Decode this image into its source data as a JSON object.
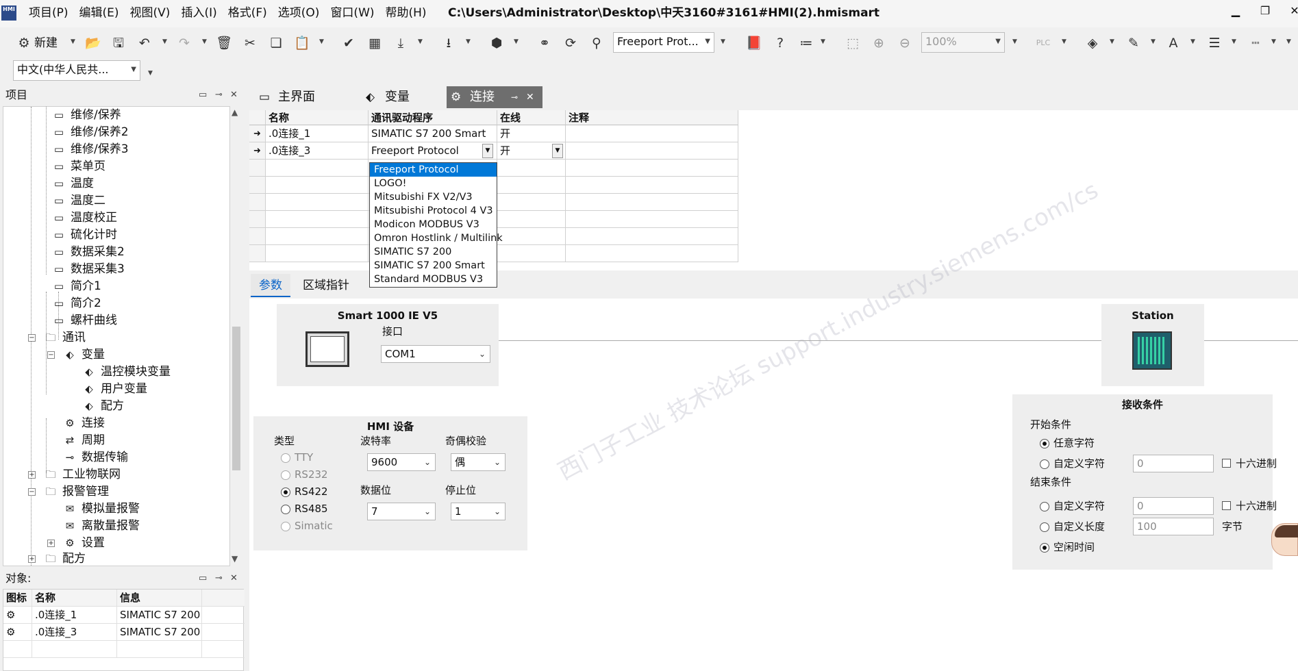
{
  "window": {
    "path": "C:\\Users\\Administrator\\Desktop\\中天3160#3161#HMI(2).hmismart",
    "logo_text": "HMI"
  },
  "menu": [
    "项目(P)",
    "编辑(E)",
    "视图(V)",
    "插入(I)",
    "格式(F)",
    "选项(O)",
    "窗口(W)",
    "帮助(H)"
  ],
  "toolbar": {
    "new_label": "新建",
    "protocol_combo": "Freeport Prot...",
    "zoom_combo": "100%",
    "language_combo": "中文(中华人民共..."
  },
  "project_panel": {
    "title": "项目",
    "tree": [
      {
        "label": "维修/保养",
        "icon": "screen-icon"
      },
      {
        "label": "维修/保养2",
        "icon": "screen-icon"
      },
      {
        "label": "维修/保养3",
        "icon": "screen-icon"
      },
      {
        "label": "菜单页",
        "icon": "screen-icon"
      },
      {
        "label": "温度",
        "icon": "screen-icon"
      },
      {
        "label": "温度二",
        "icon": "screen-icon"
      },
      {
        "label": "温度校正",
        "icon": "screen-icon"
      },
      {
        "label": "硫化计时",
        "icon": "screen-icon"
      },
      {
        "label": "数据采集2",
        "icon": "screen-icon"
      },
      {
        "label": "数据采集3",
        "icon": "screen-icon"
      },
      {
        "label": "简介1",
        "icon": "screen-icon"
      },
      {
        "label": "简介2",
        "icon": "screen-icon"
      },
      {
        "label": "螺杆曲线",
        "icon": "screen-icon"
      },
      {
        "label": "通讯",
        "icon": "folder-icon"
      },
      {
        "label": "变量",
        "icon": "tag-icon"
      },
      {
        "label": "温控模块变量",
        "icon": "tag-icon"
      },
      {
        "label": "用户变量",
        "icon": "tag-icon"
      },
      {
        "label": "配方",
        "icon": "tag-icon"
      },
      {
        "label": "连接",
        "icon": "connection-icon"
      },
      {
        "label": "周期",
        "icon": "cycle-icon"
      },
      {
        "label": "数据传输",
        "icon": "transfer-icon"
      },
      {
        "label": "工业物联网",
        "icon": "folder-icon"
      },
      {
        "label": "报警管理",
        "icon": "folder-icon"
      },
      {
        "label": "模拟量报警",
        "icon": "alarm-icon"
      },
      {
        "label": "离散量报警",
        "icon": "alarm-icon"
      },
      {
        "label": "设置",
        "icon": "settings-icon"
      },
      {
        "label": "配方",
        "icon": "folder-icon"
      }
    ]
  },
  "object_panel": {
    "title": "对象:",
    "headers": [
      "图标",
      "名称",
      "信息"
    ],
    "rows": [
      {
        "name": ".0连接_1",
        "info": "SIMATIC S7 200 ..."
      },
      {
        "name": ".0连接_3",
        "info": "SIMATIC S7 200 ..."
      }
    ]
  },
  "tabs": [
    {
      "label": "主界面",
      "icon": "screen-icon"
    },
    {
      "label": "变量",
      "icon": "tag-icon"
    },
    {
      "label": "连接",
      "icon": "connection-icon"
    }
  ],
  "grid": {
    "headers": [
      "名称",
      "通讯驱动程序",
      "在线",
      "注释"
    ],
    "rows": [
      {
        "name": ".0连接_1",
        "driver": "SIMATIC S7 200 Smart",
        "online": "开",
        "comment": ""
      },
      {
        "name": ".0连接_3",
        "driver": "Freeport Protocol",
        "online": "开",
        "comment": ""
      }
    ]
  },
  "driver_options": [
    "Freeport Protocol",
    "LOGO!",
    "Mitsubishi FX V2/V3",
    "Mitsubishi Protocol 4 V3",
    "Modicon MODBUS V3",
    "Omron Hostlink / Multilink",
    "SIMATIC S7 200",
    "SIMATIC S7 200 Smart",
    "Standard MODBUS V3"
  ],
  "param_tabs": [
    "参数",
    "区域指针"
  ],
  "device": {
    "name": "Smart 1000 IE V5",
    "interface_label": "接口",
    "interface_value": "COM1"
  },
  "station": {
    "title": "Station"
  },
  "hmi_device": {
    "title": "HMI 设备",
    "type_label": "类型",
    "types": [
      "TTY",
      "RS232",
      "RS422",
      "RS485",
      "Simatic"
    ],
    "baud_label": "波特率",
    "baud_value": "9600",
    "parity_label": "奇偶校验",
    "parity_value": "偶",
    "databits_label": "数据位",
    "databits_value": "7",
    "stopbits_label": "停止位",
    "stopbits_value": "1"
  },
  "receive": {
    "title": "接收条件",
    "start_label": "开始条件",
    "any_char": "任意字符",
    "custom_char": "自定义字符",
    "custom_char_value": "0",
    "hex_label": "十六进制",
    "end_label": "结束条件",
    "end_custom_char": "自定义字符",
    "end_custom_char_value": "0",
    "custom_length": "自定义长度",
    "custom_length_value": "100",
    "bytes_label": "字节",
    "idle_time": "空闲时间"
  },
  "watermark": "西门子工业 技术论坛 support.industry.siemens.com/cs"
}
